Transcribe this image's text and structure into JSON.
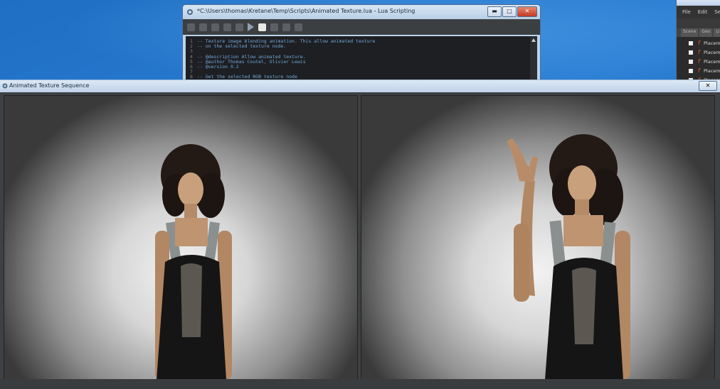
{
  "editor": {
    "title": "*C:\\Users\\thomas\\Kretane\\Temp\\Scripts\\Animated Texture.lua - Lua Scripting",
    "code_lines": [
      {
        "num": "1",
        "text": "-- Texture image blending animation. This allow animated texture"
      },
      {
        "num": "2",
        "text": "-- on the selected texture node."
      },
      {
        "num": "3",
        "text": ""
      },
      {
        "num": "4",
        "text": "-- @description Allow animated texture."
      },
      {
        "num": "5",
        "text": "-- @author      Thomas Coutel, Olivier Lewis"
      },
      {
        "num": "6",
        "text": "-- @version     0.2"
      },
      {
        "num": "7",
        "text": ""
      },
      {
        "num": "8",
        "text": "-- Get the selected RGB texture node"
      }
    ],
    "controls": {
      "minimize": "▬",
      "maximize": "□",
      "close": "✕"
    }
  },
  "side_window": {
    "menu": [
      "File",
      "Edit",
      "Se"
    ],
    "tabs": [
      "Scene",
      "Geo",
      "Li"
    ],
    "rows": [
      "Placement",
      "Placement",
      "Placement",
      "Placement",
      "Placement"
    ]
  },
  "viewer": {
    "title": "Animated Texture Sequence",
    "close_glyph": "✕"
  },
  "colors": {
    "desktop": "#2b7fd4",
    "viewer_bg": "#3e4144",
    "editor_bg": "#1e1f22",
    "comment": "#6fa8dc"
  }
}
